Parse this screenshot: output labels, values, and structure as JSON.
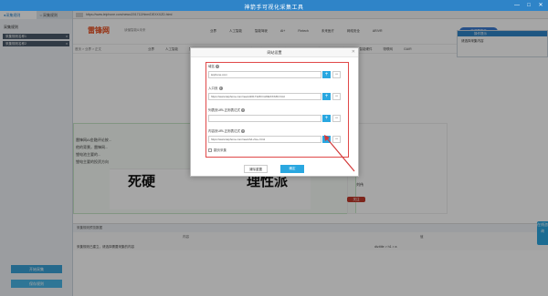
{
  "window": {
    "title": "神箭手可视化采集工具",
    "controls": [
      "—",
      "□",
      "✕"
    ]
  },
  "left_panel": {
    "tabs": [
      {
        "label": "●采集规则"
      },
      {
        "label": "○ 采集规则"
      }
    ],
    "section_label": "采集规则",
    "items": [
      {
        "label": "采集规则名称1",
        "close": "x"
      },
      {
        "label": "采集规则名称2",
        "close": "x"
      }
    ],
    "buttons": {
      "primary": "开始采集",
      "secondary": "保存规则"
    }
  },
  "browser": {
    "url": "https://www.leiphone.com/news/201712/hlrm/DEXXXZD.html"
  },
  "site": {
    "logo": "雷锋网",
    "logo_sub": "读懂智能&未来",
    "nav": [
      "业界",
      "人工智能",
      "智能驾驶",
      "AI+",
      "Fintech",
      "未来医疗",
      "网络安全",
      "AR/VR"
    ],
    "top_button": "申请雷锋号",
    "mininav": [
      "业界",
      "人工智能",
      "智能驾驶",
      "AI+",
      "Fintech",
      "未来医疗",
      "网络安全",
      "AR/VR",
      "机器人",
      "开发者",
      "智能硬件",
      "物联网",
      "GAIR"
    ],
    "breadcrumb": "首页 > 业界 > 正文",
    "article_lines": [
      "雷锋网AI金融评论按...",
      "他的背景，雷锋网...",
      "锂电池主要的...",
      "锂电主要的投资方向"
    ],
    "poster_left": "死硬",
    "poster_right": "理性派",
    "author_name": "刘伟",
    "follow_btn": "关注"
  },
  "right_popup": {
    "title": "操作提示",
    "item": "请选择采集内容"
  },
  "side_tab": "在线咨询",
  "bottom_panel": {
    "title": "采集规则预览数据",
    "col1": "内容",
    "col2": "值",
    "row_text": "采集规则已建立，请选择需要采集的内容",
    "row_value": "div.title > h1 > a"
  },
  "dialog": {
    "title": "网站设置",
    "close": "✕",
    "fields": [
      {
        "label": "域名",
        "value": "leiphone.com"
      },
      {
        "label": "入口页",
        "value": "https://www.leiphone.com/news/201712/hlrm/DEXXXZD.html"
      },
      {
        "label": "列表页URL正则表达式",
        "value": ""
      },
      {
        "label": "内容页URL正则表达式",
        "value": "https://www.leiphone.com/news/\\d+/\\w+.html"
      }
    ],
    "plus": "+",
    "minus": "−",
    "checkbox_label": "翻页采集",
    "reset_label": "清除重置",
    "confirm_label": "确定"
  }
}
